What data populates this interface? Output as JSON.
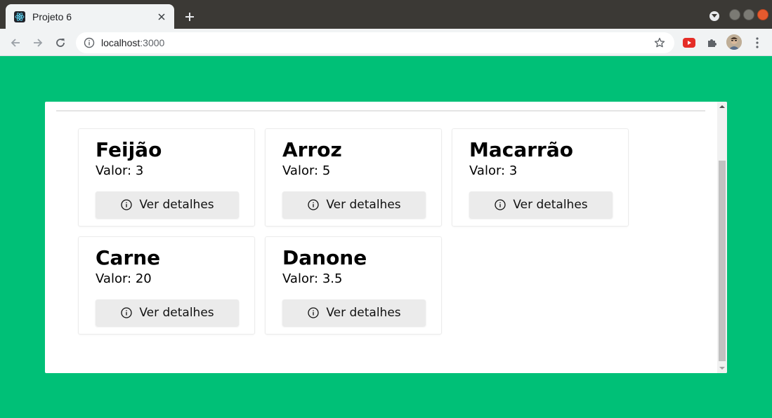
{
  "browser": {
    "tab_title": "Projeto 6",
    "url_host": "localhost",
    "url_port": ":3000",
    "icons": [
      "react-favicon-icon",
      "tab-close-icon",
      "new-tab-icon",
      "back-icon",
      "forward-icon",
      "reload-icon",
      "site-info-icon",
      "bookmark-star-icon",
      "youtube-extension-icon",
      "extensions-puzzle-icon",
      "profile-avatar",
      "kebab-menu-icon"
    ]
  },
  "colors": {
    "page_background": "#00c077",
    "panel_background": "#ffffff",
    "button_background": "#ebebeb"
  },
  "products": [
    {
      "name": "Feijão",
      "value_text": "Valor: 3",
      "button_label": "Ver detalhes"
    },
    {
      "name": "Arroz",
      "value_text": "Valor: 5",
      "button_label": "Ver detalhes"
    },
    {
      "name": "Macarrão",
      "value_text": "Valor: 3",
      "button_label": "Ver detalhes"
    },
    {
      "name": "Carne",
      "value_text": "Valor: 20",
      "button_label": "Ver detalhes"
    },
    {
      "name": "Danone",
      "value_text": "Valor: 3.5",
      "button_label": "Ver detalhes"
    }
  ]
}
